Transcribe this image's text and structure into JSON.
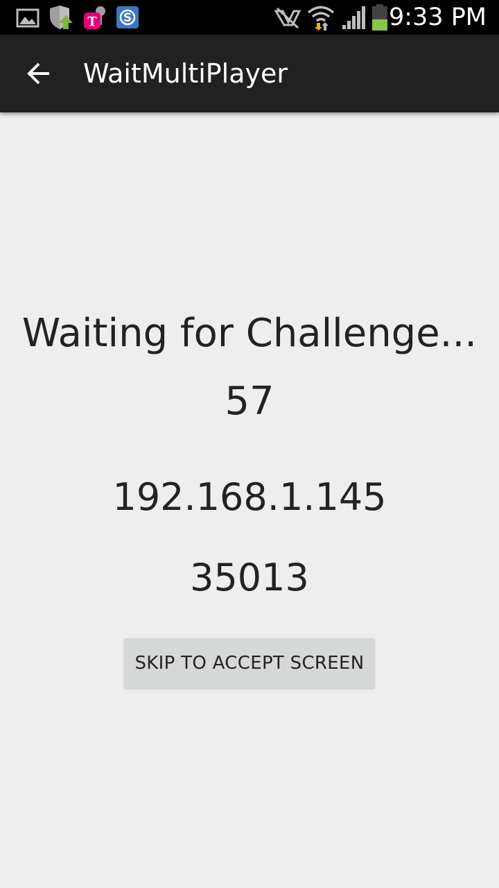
{
  "status_bar": {
    "time": "9:33 PM",
    "left_icons": [
      "gallery-icon",
      "shield-update-icon",
      "tmobile-icon",
      "skype-icon"
    ],
    "right_icons": [
      "nfc-icon",
      "wifi-icon",
      "signal-icon",
      "battery-icon"
    ],
    "colors": {
      "background": "#000000",
      "battery_fill": "#8bc34a",
      "skype_blue": "#3a78c4",
      "tmobile_magenta": "#e20074"
    }
  },
  "app_bar": {
    "title": "WaitMultiPlayer",
    "back_icon": "arrow-back-icon",
    "background": "#212121"
  },
  "main": {
    "waiting_label": "Waiting for Challenge...",
    "countdown": "57",
    "ip_address": "192.168.1.145",
    "port": "35013",
    "skip_button_label": "SKIP TO ACCEPT SCREEN",
    "background": "#eeeeee"
  }
}
